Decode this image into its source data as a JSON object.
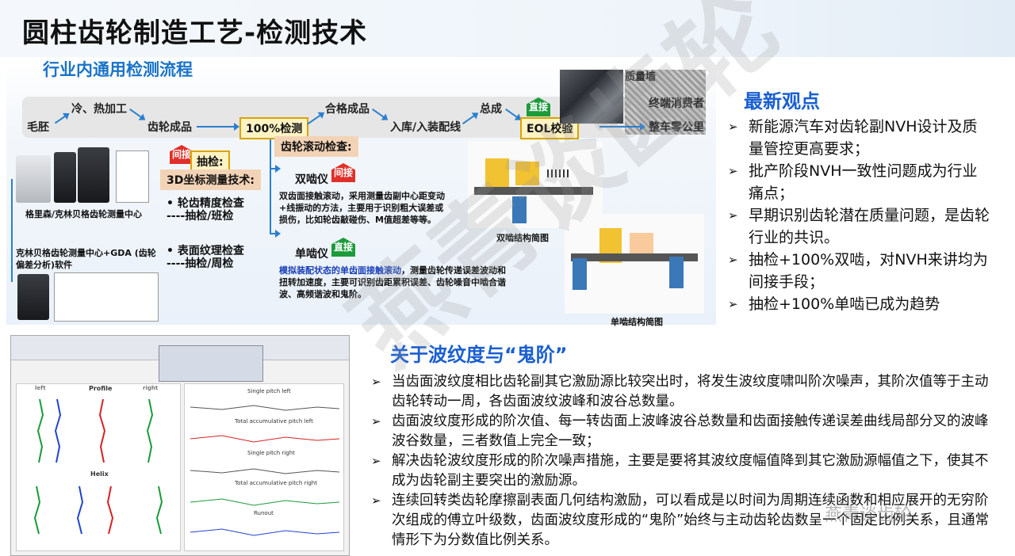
{
  "title": "圆柱齿轮制造工艺-检测技术",
  "flow": {
    "title": "行业内通用检测流程",
    "steps": {
      "blank": "毛胚",
      "hot_cold": "冷、热加工",
      "gear_finished": "齿轮成品",
      "check100": "100%检测",
      "qualified": "合格成品",
      "warehouse": "入库/入装配线",
      "assembly": "总成",
      "eol": "EOL校验",
      "quality_wall": "质量墙",
      "end_consumer": "终端消费者",
      "vehicle_km": "整车零公里"
    },
    "tags": {
      "indirect": "间接",
      "direct": "直接"
    },
    "sampling": "抽检:",
    "cmm_title": "3D坐标测量技术:",
    "cmm_items": [
      {
        "line1": "•    轮齿精度检查",
        "line2": "----抽检/班检"
      },
      {
        "line1": "•    表面纹理检查",
        "line2": "----抽检/周检"
      }
    ],
    "rolling_title": "齿轮滚动检查:",
    "double_flank": {
      "name": "双啮仪",
      "desc": "双齿面接触滚动，采用测量齿副中心距变动+线振动的方法，主要用于识别粗大误差或损伤，比如轮齿敲碰伤、M值超差等等。"
    },
    "single_flank": {
      "name": "单啮仪",
      "desc_highlight": "模拟装配状态的单齿面接触滚动",
      "desc": "，测量齿轮传递误差波动和扭转加速度，主要可识别齿距累积误差、齿轮噪音中啮合谐波、高频谐波和鬼阶。"
    },
    "machine_label1": "格里森/克林贝格齿轮测量中心",
    "machine_label2": "克林贝格齿轮测量中心+GDA (齿轮偏差分析)软件",
    "double_diagram_caption": "双啮结构简图",
    "single_diagram_caption": "单啮结构简图"
  },
  "viewpoints": {
    "title": "最新观点",
    "items": [
      "新能源汽车对齿轮副NVH设计及质量管控更高要求；",
      "批产阶段NVH一致性问题成为行业痛点；",
      "早期识别齿轮潜在质量问题，是齿轮行业的共识。",
      "抽检+100%双啮，对NVH来讲均为间接手段；",
      "抽检+100%单啮已成为趋势"
    ]
  },
  "waviness": {
    "title": "关于波纹度与“鬼阶”",
    "items": [
      "当齿面波纹度相比齿轮副其它激励源比较突出时，将发生波纹度啸叫阶次噪声，其阶次值等于主动齿轮转动一周，各齿面波纹波峰和波谷总数量。",
      "齿面波纹度形成的阶次值、每一转齿面上波峰波谷总数量和齿面接触传递误差曲线局部分叉的波峰波谷数量，三者数值上完全一致；",
      "解决齿轮波纹度形成的阶次噪声措施，主要是要将其波纹度幅值降到其它激励源幅值之下，使其不成为齿轮副主要突出的激励源。",
      "连续回转类齿轮摩擦副表面几何结构激励，可以看成是以时间为周期连续函数和相应展开的无穷阶次组成的傅立叶级数，齿面波纹度形成的“鬼阶”始终与主动齿轮齿数呈一个固定比例关系，且通常情形下为分数值比例关系。"
    ]
  },
  "software": {
    "profile": "Profile",
    "helix": "Helix",
    "single_pitch_left": "Single pitch left",
    "total_pitch_left": "Total accumulative pitch left",
    "single_pitch_right": "Single pitch right",
    "total_pitch_right": "Total accumulative pitch right",
    "runout": "Runout",
    "left": "left",
    "right": "right"
  },
  "watermark": "燕青谈齿轮",
  "colors": {
    "accent": "#1a5fd0",
    "flow_blue": "#2a7fd0",
    "tag_red": "#e0302a",
    "tag_green": "#1c9b3b"
  }
}
